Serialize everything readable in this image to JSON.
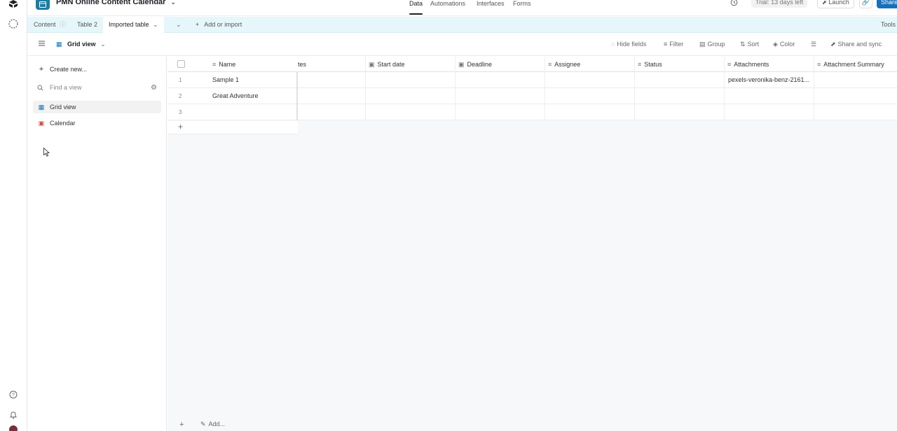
{
  "header": {
    "base_title": "PMN Online Content Calendar",
    "nav": [
      {
        "label": "Data",
        "active": true
      },
      {
        "label": "Automations",
        "active": false
      },
      {
        "label": "Interfaces",
        "active": false
      },
      {
        "label": "Forms",
        "active": false
      }
    ],
    "trial": "Trial: 13 days left",
    "launch": "Launch",
    "share": "Share"
  },
  "tabs": {
    "items": [
      "Content",
      "Table 2",
      "Imported table"
    ],
    "add_or_import": "Add or import",
    "tools": "Tools"
  },
  "viewbar": {
    "view_name": "Grid view",
    "hide_fields": "Hide fields",
    "filter": "Filter",
    "group": "Group",
    "sort": "Sort",
    "color": "Color",
    "share_sync": "Share and sync"
  },
  "sidebar": {
    "create_new": "Create new...",
    "find_placeholder": "Find a view",
    "views": [
      {
        "label": "Grid view",
        "selected": true,
        "icon": "grid-icon"
      },
      {
        "label": "Calendar",
        "selected": false,
        "icon": "calendar-icon"
      }
    ]
  },
  "grid": {
    "columns": [
      "Name",
      "tes",
      "Start date",
      "Deadline",
      "Assignee",
      "Status",
      "Attachments",
      "Attachment Summary"
    ],
    "rows": [
      {
        "num": "1",
        "name": "Sample 1",
        "attachments": "pexels-veronika-benz-2161..."
      },
      {
        "num": "2",
        "name": "Great Adventure",
        "attachments": ""
      },
      {
        "num": "3",
        "name": "",
        "attachments": ""
      }
    ],
    "footer_add": "Add..."
  },
  "colors": {
    "accent": "#1570b8",
    "tabs_bg": "#e6f7fb",
    "base_icon": "#1d7ca3"
  }
}
